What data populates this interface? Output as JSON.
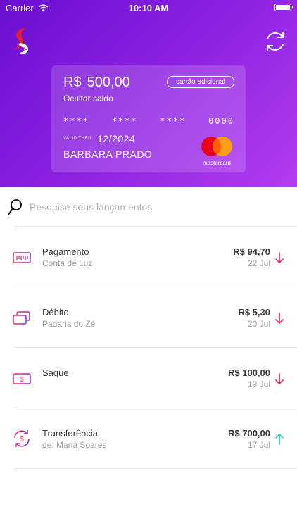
{
  "status_bar": {
    "carrier": "Carrier",
    "time": "10:10 AM"
  },
  "header": {
    "logo_icon": "brand-logo-icon",
    "refresh_icon": "refresh-icon"
  },
  "card": {
    "currency": "R$",
    "balance": "500,00",
    "hide_balance_label": "Ocultar saldo",
    "badge": "cartão adicional",
    "number_groups": [
      "****",
      "****",
      "****",
      "0000"
    ],
    "valid_thru_label": "VALID THRU",
    "valid_thru": "12/2024",
    "holder": "BARBARA PRADO",
    "brand": "mastercard"
  },
  "search": {
    "placeholder": "Pesquise seus lançamentos"
  },
  "transactions": [
    {
      "title": "Pagamento",
      "subtitle": "Conta de Luz",
      "amount": "R$ 94,70",
      "date": "22 Jul",
      "direction": "down",
      "icon": "barcode-icon"
    },
    {
      "title": "Débito",
      "subtitle": "Padaria do Zé",
      "amount": "R$ 5,30",
      "date": "20 Jul",
      "direction": "down",
      "icon": "debit-card-icon"
    },
    {
      "title": "Saque",
      "subtitle": "",
      "amount": "R$ 100,00",
      "date": "19 Jul",
      "direction": "down",
      "icon": "cash-icon"
    },
    {
      "title": "Transferência",
      "subtitle": "de: Maria Soares",
      "amount": "R$ 700,00",
      "date": "17 Jul",
      "direction": "up",
      "icon": "transfer-icon"
    }
  ],
  "colors": {
    "accent_start": "#6a0fd0",
    "accent_end": "#b33df0",
    "outgoing": "#e8365d",
    "incoming": "#2ed6b5"
  }
}
